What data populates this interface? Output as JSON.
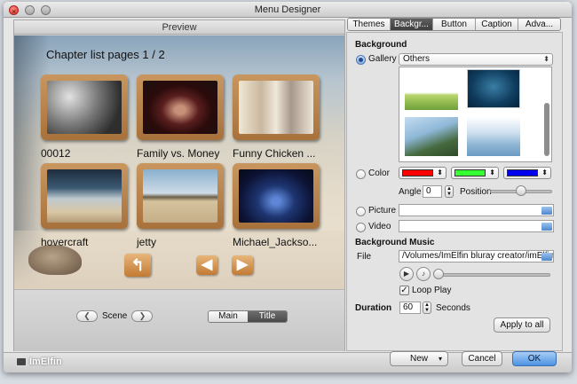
{
  "window": {
    "title": "Menu Designer"
  },
  "preview": {
    "header": "Preview",
    "stage_title": "Chapter list pages 1 / 2",
    "chapters": [
      {
        "caption": "00012"
      },
      {
        "caption": "Family vs. Money"
      },
      {
        "caption": "Funny Chicken ..."
      },
      {
        "caption": "hovercraft"
      },
      {
        "caption": "jetty"
      },
      {
        "caption": "Michael_Jackso..."
      }
    ],
    "scene_label": "Scene",
    "segment": [
      "Main",
      "Title"
    ],
    "segment_selected": "Title"
  },
  "tabs": [
    "Themes",
    "Backgr...",
    "Button",
    "Caption",
    "Adva..."
  ],
  "tab_selected": "Backgr...",
  "background": {
    "section_label": "Background",
    "gallery_label": "Gallery",
    "gallery_selected": "Others",
    "color_label": "Color",
    "colors": [
      "#ff0000",
      "#33ff33",
      "#0000ee"
    ],
    "angle_label": "Angle",
    "angle_value": "0",
    "position_label": "Position",
    "position_fraction": 0.5,
    "picture_label": "Picture",
    "picture_value": "",
    "video_label": "Video",
    "video_value": ""
  },
  "music": {
    "section_label": "Background Music",
    "file_label": "File",
    "file_value": "/Volumes/ImElfin bluray creator/imElfin Bl",
    "loop_label": "Loop Play",
    "loop_checked": true,
    "duration_label": "Duration",
    "duration_value": "60",
    "seconds_label": "Seconds",
    "apply_all_label": "Apply to all"
  },
  "footer": {
    "logo_text": "ImElfin",
    "new_label": "New",
    "cancel_label": "Cancel",
    "ok_label": "OK"
  }
}
